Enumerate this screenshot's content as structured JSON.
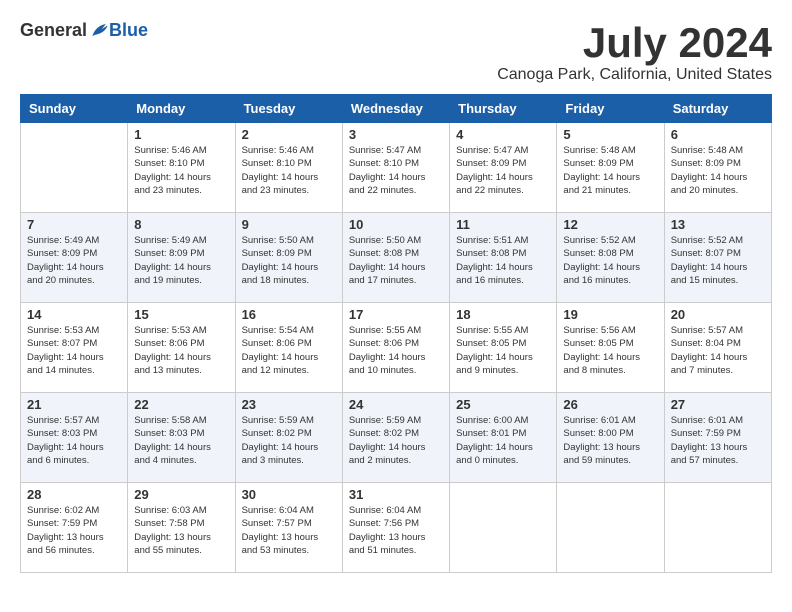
{
  "header": {
    "logo_general": "General",
    "logo_blue": "Blue",
    "month_title": "July 2024",
    "location": "Canoga Park, California, United States"
  },
  "weekdays": [
    "Sunday",
    "Monday",
    "Tuesday",
    "Wednesday",
    "Thursday",
    "Friday",
    "Saturday"
  ],
  "weeks": [
    [
      {
        "day": "",
        "info": ""
      },
      {
        "day": "1",
        "info": "Sunrise: 5:46 AM\nSunset: 8:10 PM\nDaylight: 14 hours\nand 23 minutes."
      },
      {
        "day": "2",
        "info": "Sunrise: 5:46 AM\nSunset: 8:10 PM\nDaylight: 14 hours\nand 23 minutes."
      },
      {
        "day": "3",
        "info": "Sunrise: 5:47 AM\nSunset: 8:10 PM\nDaylight: 14 hours\nand 22 minutes."
      },
      {
        "day": "4",
        "info": "Sunrise: 5:47 AM\nSunset: 8:09 PM\nDaylight: 14 hours\nand 22 minutes."
      },
      {
        "day": "5",
        "info": "Sunrise: 5:48 AM\nSunset: 8:09 PM\nDaylight: 14 hours\nand 21 minutes."
      },
      {
        "day": "6",
        "info": "Sunrise: 5:48 AM\nSunset: 8:09 PM\nDaylight: 14 hours\nand 20 minutes."
      }
    ],
    [
      {
        "day": "7",
        "info": "Sunrise: 5:49 AM\nSunset: 8:09 PM\nDaylight: 14 hours\nand 20 minutes."
      },
      {
        "day": "8",
        "info": "Sunrise: 5:49 AM\nSunset: 8:09 PM\nDaylight: 14 hours\nand 19 minutes."
      },
      {
        "day": "9",
        "info": "Sunrise: 5:50 AM\nSunset: 8:09 PM\nDaylight: 14 hours\nand 18 minutes."
      },
      {
        "day": "10",
        "info": "Sunrise: 5:50 AM\nSunset: 8:08 PM\nDaylight: 14 hours\nand 17 minutes."
      },
      {
        "day": "11",
        "info": "Sunrise: 5:51 AM\nSunset: 8:08 PM\nDaylight: 14 hours\nand 16 minutes."
      },
      {
        "day": "12",
        "info": "Sunrise: 5:52 AM\nSunset: 8:08 PM\nDaylight: 14 hours\nand 16 minutes."
      },
      {
        "day": "13",
        "info": "Sunrise: 5:52 AM\nSunset: 8:07 PM\nDaylight: 14 hours\nand 15 minutes."
      }
    ],
    [
      {
        "day": "14",
        "info": "Sunrise: 5:53 AM\nSunset: 8:07 PM\nDaylight: 14 hours\nand 14 minutes."
      },
      {
        "day": "15",
        "info": "Sunrise: 5:53 AM\nSunset: 8:06 PM\nDaylight: 14 hours\nand 13 minutes."
      },
      {
        "day": "16",
        "info": "Sunrise: 5:54 AM\nSunset: 8:06 PM\nDaylight: 14 hours\nand 12 minutes."
      },
      {
        "day": "17",
        "info": "Sunrise: 5:55 AM\nSunset: 8:06 PM\nDaylight: 14 hours\nand 10 minutes."
      },
      {
        "day": "18",
        "info": "Sunrise: 5:55 AM\nSunset: 8:05 PM\nDaylight: 14 hours\nand 9 minutes."
      },
      {
        "day": "19",
        "info": "Sunrise: 5:56 AM\nSunset: 8:05 PM\nDaylight: 14 hours\nand 8 minutes."
      },
      {
        "day": "20",
        "info": "Sunrise: 5:57 AM\nSunset: 8:04 PM\nDaylight: 14 hours\nand 7 minutes."
      }
    ],
    [
      {
        "day": "21",
        "info": "Sunrise: 5:57 AM\nSunset: 8:03 PM\nDaylight: 14 hours\nand 6 minutes."
      },
      {
        "day": "22",
        "info": "Sunrise: 5:58 AM\nSunset: 8:03 PM\nDaylight: 14 hours\nand 4 minutes."
      },
      {
        "day": "23",
        "info": "Sunrise: 5:59 AM\nSunset: 8:02 PM\nDaylight: 14 hours\nand 3 minutes."
      },
      {
        "day": "24",
        "info": "Sunrise: 5:59 AM\nSunset: 8:02 PM\nDaylight: 14 hours\nand 2 minutes."
      },
      {
        "day": "25",
        "info": "Sunrise: 6:00 AM\nSunset: 8:01 PM\nDaylight: 14 hours\nand 0 minutes."
      },
      {
        "day": "26",
        "info": "Sunrise: 6:01 AM\nSunset: 8:00 PM\nDaylight: 13 hours\nand 59 minutes."
      },
      {
        "day": "27",
        "info": "Sunrise: 6:01 AM\nSunset: 7:59 PM\nDaylight: 13 hours\nand 57 minutes."
      }
    ],
    [
      {
        "day": "28",
        "info": "Sunrise: 6:02 AM\nSunset: 7:59 PM\nDaylight: 13 hours\nand 56 minutes."
      },
      {
        "day": "29",
        "info": "Sunrise: 6:03 AM\nSunset: 7:58 PM\nDaylight: 13 hours\nand 55 minutes."
      },
      {
        "day": "30",
        "info": "Sunrise: 6:04 AM\nSunset: 7:57 PM\nDaylight: 13 hours\nand 53 minutes."
      },
      {
        "day": "31",
        "info": "Sunrise: 6:04 AM\nSunset: 7:56 PM\nDaylight: 13 hours\nand 51 minutes."
      },
      {
        "day": "",
        "info": ""
      },
      {
        "day": "",
        "info": ""
      },
      {
        "day": "",
        "info": ""
      }
    ]
  ]
}
